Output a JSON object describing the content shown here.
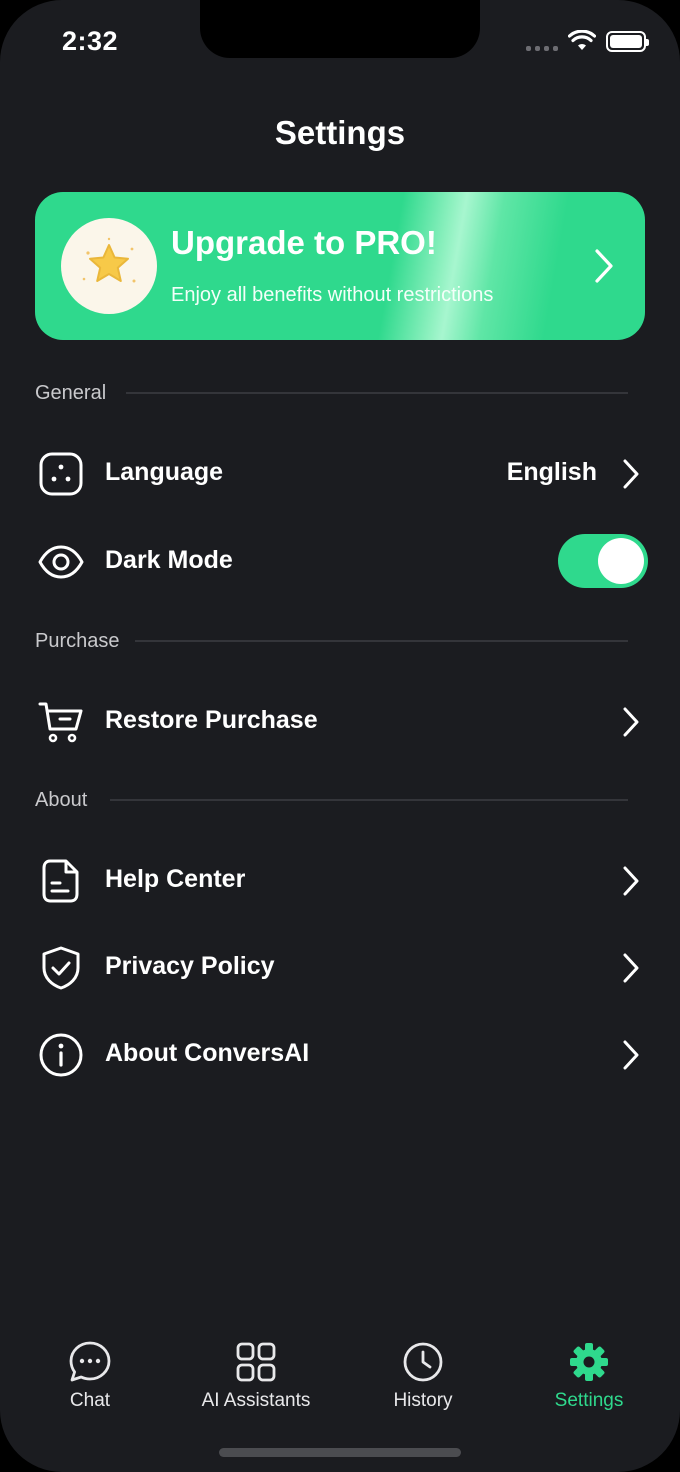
{
  "status_bar": {
    "time": "2:32"
  },
  "header": {
    "title": "Settings"
  },
  "promo": {
    "title": "Upgrade to PRO!",
    "subtitle": "Enjoy all benefits without restrictions",
    "icon": "star-icon"
  },
  "sections": {
    "general": "General",
    "purchase": "Purchase",
    "about": "About"
  },
  "rows": {
    "language": {
      "label": "Language",
      "value": "English",
      "icon": "language-icon"
    },
    "dark_mode": {
      "label": "Dark Mode",
      "enabled": true,
      "icon": "eye-icon"
    },
    "restore": {
      "label": "Restore Purchase",
      "icon": "cart-icon"
    },
    "help": {
      "label": "Help Center",
      "icon": "document-icon"
    },
    "privacy": {
      "label": "Privacy Policy",
      "icon": "shield-check-icon"
    },
    "about_app": {
      "label": "About ConversAI",
      "icon": "info-icon"
    }
  },
  "tabs": [
    {
      "label": "Chat",
      "icon": "chat-bubble-icon",
      "active": false
    },
    {
      "label": "AI Assistants",
      "icon": "grid-icon",
      "active": false
    },
    {
      "label": "History",
      "icon": "clock-icon",
      "active": false
    },
    {
      "label": "Settings",
      "icon": "gear-icon",
      "active": true
    }
  ],
  "colors": {
    "background": "#1b1c20",
    "accent": "#2fd98d",
    "divider": "#34353a",
    "star": "#f7c948"
  }
}
